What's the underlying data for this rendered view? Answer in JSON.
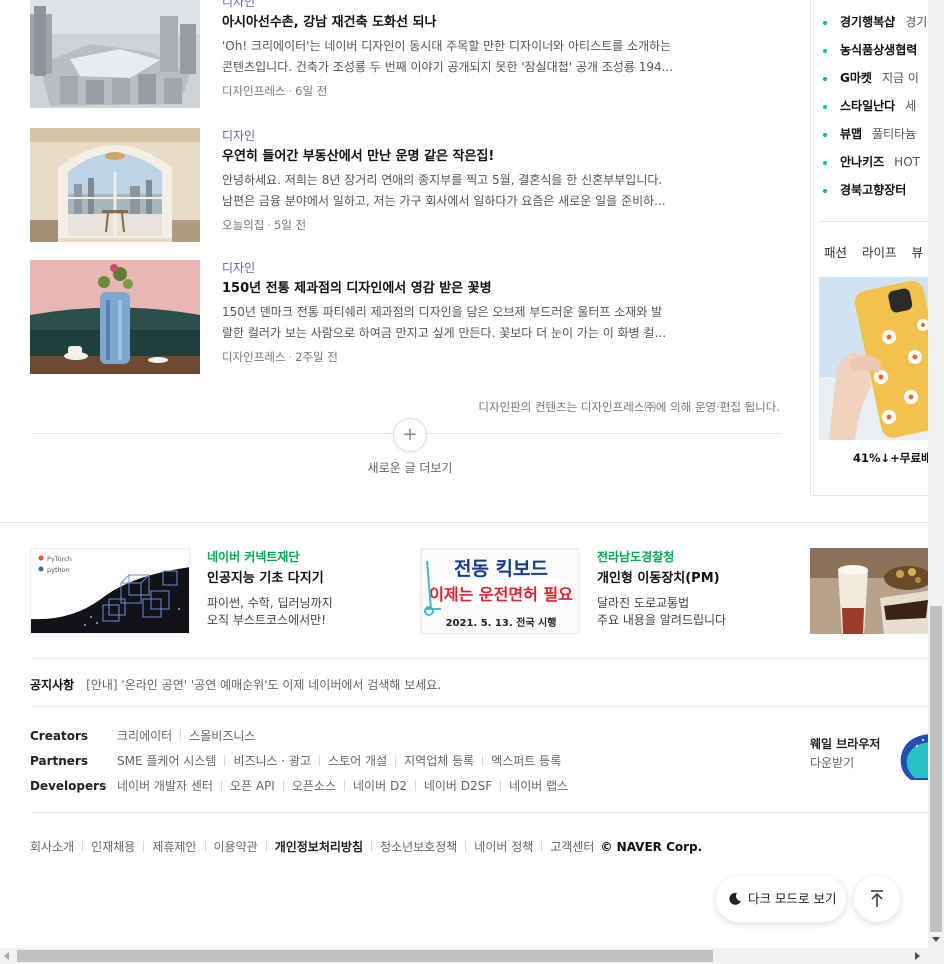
{
  "feed": {
    "items": [
      {
        "category": "디자인",
        "title": "아시아선수촌, 강남 재건축 도화선 되나",
        "summary_line1": "'Oh! 크리에이터'는 네이버 디자인이 동시대 주목할 만한 디자이너와 아티스트를 소개하는",
        "summary_line2": "콘텐츠입니다. 건축가 조성룡 두 번째 이야기 공개되지 못한 '잠실대첩' 공개 조성룡 194...",
        "source": "디자인프레스",
        "time": "6일 전"
      },
      {
        "category": "디자인",
        "title": "우연히 들어간 부동산에서 만난 운명 같은 작은집!",
        "summary_line1": "안녕하세요. 저희는 8년 장거리 연애의 종지부를 찍고 5월, 결혼식을 한 신혼부부입니다.",
        "summary_line2": "남편은 금융 분야에서 일하고, 저는 가구 회사에서 일하다가 요즘은 새로운 일을 준비하...",
        "source": "오늘의집",
        "time": "5일 전"
      },
      {
        "category": "디자인",
        "title": "150년 전통 제과점의 디자인에서 영감 받은 꽃병",
        "summary_line1": "150년 덴마크 전통 파티쉐리 제과점의 디자인을 담은 오브제 부드러운 울터프 소재와 발",
        "summary_line2": "랄한 컬러가 보는 사람으로 하여금 만지고 싶게 만든다. 꽃보다 더 눈이 가는 이 화병 컬...",
        "source": "디자인프레스",
        "time": "2주일 전"
      }
    ],
    "source_notice": "디자인판의 컨텐츠는 디자인프레스㈜에 의해 운영·편집 됩니다.",
    "more_icon": "+",
    "more_label": "새로운 글 더보기"
  },
  "sidebar": {
    "shops": [
      {
        "name": "경기행복샵",
        "desc": "경기"
      },
      {
        "name": "농식품상생협력",
        "desc": ""
      },
      {
        "name": "G마켓",
        "desc": "지금 이"
      },
      {
        "name": "스타일난다",
        "desc": "세"
      },
      {
        "name": "뷰맵",
        "desc": "풀티타늄"
      },
      {
        "name": "안나키즈",
        "desc": "HOT"
      },
      {
        "name": "경북고향장터",
        "desc": ""
      }
    ],
    "tabs": [
      "패션",
      "라이프",
      "뷰"
    ],
    "product_price": "41%↓+무료배"
  },
  "banners": [
    {
      "org": "네이버 커넥트재단",
      "title": "인공지능 기초 다지기",
      "desc1": "파이썬, 수학, 딥러닝까지",
      "desc2": "오직 부스트코스에서만!",
      "img_text1": "PyTorch",
      "img_text2": "python"
    },
    {
      "org": "전라남도경찰청",
      "title": "개인형 이동장치(PM)",
      "desc1": "달라진 도로교통법",
      "desc2": "주요 내용을 알려드립니다",
      "img_title": "전동 킥보드",
      "img_sub": "이제는 운전면허 필요",
      "img_date": "2021. 5. 13. 전국 시행"
    }
  ],
  "notice": {
    "label": "공지사항",
    "text": "[안내] '온라인 공연' '공연 예매순위'도 이제 네이버에서 검색해 보세요."
  },
  "links": {
    "creators": {
      "label": "Creators",
      "items": [
        "크리에이터",
        "스몰비즈니스"
      ]
    },
    "partners": {
      "label": "Partners",
      "items": [
        "SME 플케어 시스템",
        "비즈니스 · 광고",
        "스토어 개설",
        "지역업체 등록",
        "엑스퍼트 등록"
      ]
    },
    "developers": {
      "label": "Developers",
      "items": [
        "네이버 개발자 센터",
        "오픈 API",
        "오픈소스",
        "네이버 D2",
        "네이버 D2SF",
        "네이버 랩스"
      ]
    }
  },
  "whale": {
    "title": "웨일 브라우저",
    "download": "다운받기"
  },
  "footer": {
    "items": [
      "회사소개",
      "인재채용",
      "제휴제안",
      "이용약관",
      "개인정보처리방침",
      "청소년보호정책",
      "네이버 정책",
      "고객센터"
    ],
    "copyright": "© NAVER Corp."
  },
  "float": {
    "dark_mode_label": "다크 모드로 보기"
  },
  "colors": {
    "accent_green": "#03c75a",
    "category_purple": "#6b5ea5",
    "org_green": "#03a94d"
  },
  "icons": {
    "more": "plus-icon",
    "dark": "moon-icon",
    "top": "arrow-up-icon"
  }
}
